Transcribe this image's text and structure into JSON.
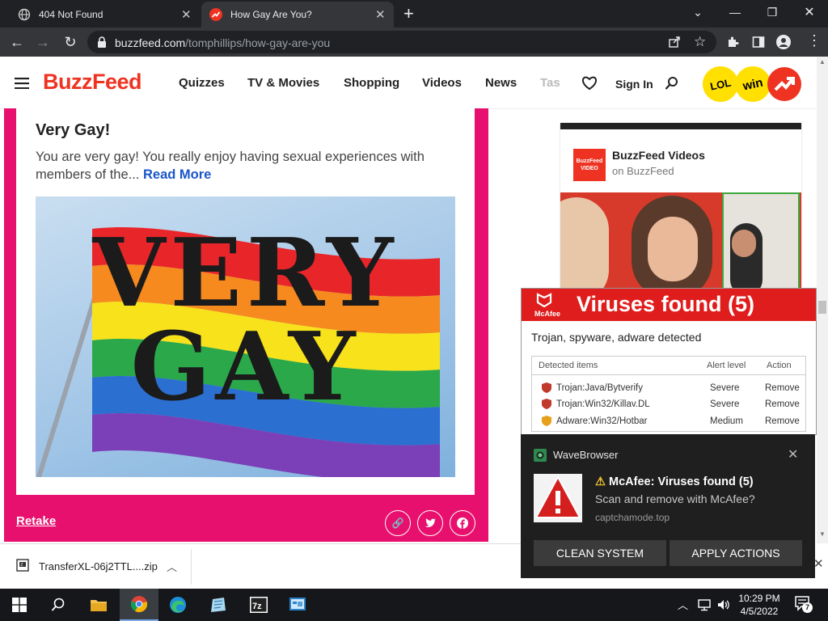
{
  "browser": {
    "tabs": [
      {
        "title": "404 Not Found",
        "active": false
      },
      {
        "title": "How Gay Are You?",
        "active": true
      }
    ],
    "new_tab_symbol": "+",
    "url_domain": "buzzfeed.com",
    "url_path": "/tomphillips/how-gay-are-you"
  },
  "site": {
    "logo": "BuzzFeed",
    "nav": [
      "Quizzes",
      "TV & Movies",
      "Shopping",
      "Videos",
      "News",
      "Tas"
    ],
    "sign_in": "Sign In",
    "badges": [
      "LOL",
      "win"
    ]
  },
  "result": {
    "title": "Very Gay!",
    "text": "You are very gay! You really enjoy having sexual experiences with members of the...",
    "read_more": "Read More",
    "image_text_line1": "VERY",
    "image_text_line2": "GAY",
    "retake": "Retake",
    "flag_colors": [
      "#e8262a",
      "#f68a1e",
      "#f7e21b",
      "#2aa84a",
      "#2b6fd1",
      "#7b3fb7"
    ]
  },
  "sidebar": {
    "channel": "BuzzFeed Videos",
    "subtitle": "on BuzzFeed",
    "logo_text_1": "BuzzFeed",
    "logo_text_2": "VIDEO"
  },
  "mcafee": {
    "brand": "McAfee",
    "title": "Viruses found (5)",
    "subtitle": "Trojan, spyware, adware detected",
    "columns": [
      "Detected items",
      "Alert level",
      "Action"
    ],
    "rows": [
      {
        "item": "Trojan:Java/Bytverify",
        "level": "Severe",
        "action": "Remove"
      },
      {
        "item": "Trojan:Win32/Killav.DL",
        "level": "Severe",
        "action": "Remove"
      },
      {
        "item": "Adware:Win32/Hotbar",
        "level": "Medium",
        "action": "Remove"
      }
    ]
  },
  "notification": {
    "app": "WaveBrowser",
    "title": "McAfee: Viruses found (5)",
    "body": "Scan and remove with McAfee?",
    "source": "captchamode.top",
    "buttons": [
      "CLEAN SYSTEM",
      "APPLY ACTIONS"
    ]
  },
  "download": {
    "filename": "TransferXL-06j2TTL....zip"
  },
  "taskbar": {
    "time": "10:29 PM",
    "date": "4/5/2022",
    "notification_count": "7"
  },
  "colors": {
    "buzzfeed_red": "#ee3322",
    "quiz_pink": "#e8106e",
    "mcafee_red": "#e01d1d",
    "link_blue": "#1a55c8"
  }
}
